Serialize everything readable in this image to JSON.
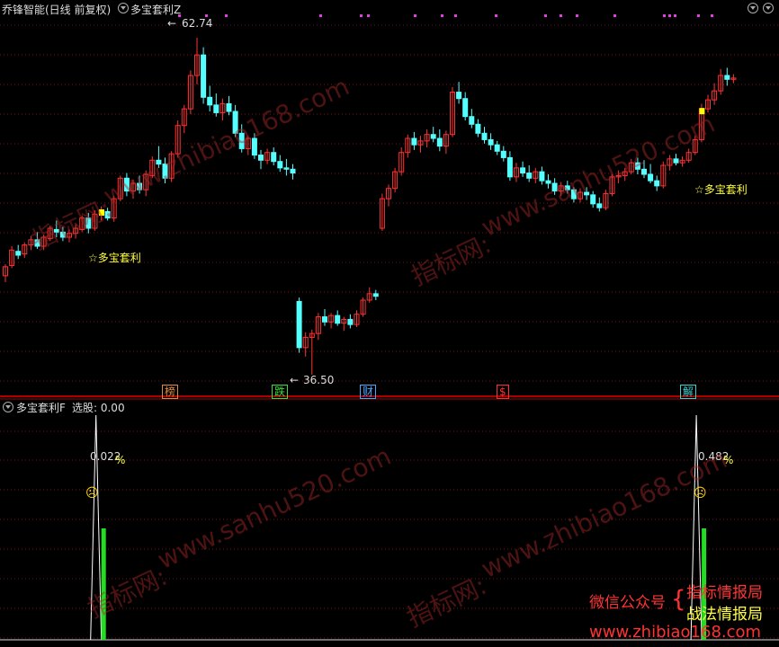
{
  "header": {
    "title": "乔锋智能(日线 前复权)",
    "indicator": "多宝套利Z",
    "sub_indicator": "多宝套利F",
    "sub_value": "选股: 0.00"
  },
  "price_labels": {
    "high": "62.74",
    "low": "36.50"
  },
  "signal_labels": {
    "left": "☆多宝套利",
    "right": "☆多宝套利"
  },
  "bottom_tags": [
    {
      "text": "榜",
      "color": "#e08a3c"
    },
    {
      "text": "跌",
      "color": "#3cdc3c"
    },
    {
      "text": "财",
      "color": "#4aa8ff"
    },
    {
      "text": "$",
      "color": "#ff3030"
    },
    {
      "text": "解",
      "color": "#3cd0d0"
    }
  ],
  "sub_labels": {
    "left_pct": "0.022",
    "right_pct": "0.482",
    "pct_sign": "%"
  },
  "watermarks": [
    "指标网:",
    "www.zhibiao168.com",
    "www.sanhu520.com"
  ],
  "ad": {
    "left": "微信公众号",
    "line1": "指标情报局",
    "line2": "战法情报局",
    "url": "www.zhibiao168.com"
  },
  "colors": {
    "up": "#ff3333",
    "down": "#54ffff",
    "signal": "#ffff00",
    "bar": "#22dd22"
  },
  "chart_data": {
    "type": "candlestick",
    "candles": [
      [
        44.2,
        45.1,
        43.7,
        44.9
      ],
      [
        45.0,
        46.5,
        44.8,
        46.2
      ],
      [
        46.1,
        46.6,
        45.5,
        45.8
      ],
      [
        45.9,
        46.8,
        45.6,
        46.6
      ],
      [
        46.6,
        47.3,
        46.2,
        47.0
      ],
      [
        47.0,
        47.6,
        46.3,
        46.5
      ],
      [
        46.5,
        47.4,
        46.2,
        47.2
      ],
      [
        47.1,
        48.1,
        46.9,
        47.9
      ],
      [
        47.8,
        48.5,
        47.2,
        47.6
      ],
      [
        47.6,
        48.0,
        46.9,
        47.2
      ],
      [
        47.2,
        47.8,
        46.8,
        47.5
      ],
      [
        47.5,
        48.2,
        47.1,
        47.9
      ],
      [
        47.8,
        48.9,
        47.6,
        48.7
      ],
      [
        48.7,
        49.1,
        47.5,
        47.9
      ],
      [
        47.9,
        49.3,
        47.7,
        49.0
      ],
      [
        49.0,
        49.6,
        48.5,
        49.3
      ],
      [
        49.2,
        49.5,
        48.5,
        48.7
      ],
      [
        48.7,
        50.4,
        48.4,
        50.2
      ],
      [
        50.2,
        52.0,
        50.0,
        51.8
      ],
      [
        51.8,
        52.2,
        50.4,
        50.8
      ],
      [
        50.8,
        51.7,
        50.2,
        51.4
      ],
      [
        51.4,
        52.0,
        50.6,
        50.9
      ],
      [
        50.9,
        52.4,
        50.4,
        52.1
      ],
      [
        52.0,
        53.5,
        51.8,
        53.2
      ],
      [
        53.2,
        54.3,
        52.6,
        52.9
      ],
      [
        52.9,
        53.4,
        51.4,
        51.8
      ],
      [
        51.8,
        53.9,
        51.5,
        53.7
      ],
      [
        53.7,
        56.3,
        53.4,
        55.9
      ],
      [
        55.9,
        57.5,
        55.3,
        57.2
      ],
      [
        57.2,
        60.2,
        56.8,
        59.8
      ],
      [
        59.8,
        62.74,
        59.1,
        61.4
      ],
      [
        61.4,
        62.0,
        57.6,
        58.1
      ],
      [
        58.1,
        59.0,
        57.0,
        57.5
      ],
      [
        57.5,
        58.4,
        56.6,
        56.9
      ],
      [
        56.9,
        58.0,
        56.3,
        57.6
      ],
      [
        57.6,
        58.2,
        56.7,
        57.0
      ],
      [
        57.0,
        57.5,
        55.0,
        55.3
      ],
      [
        55.3,
        56.0,
        53.8,
        54.1
      ],
      [
        54.1,
        55.1,
        53.6,
        54.9
      ],
      [
        54.9,
        55.3,
        53.3,
        53.6
      ],
      [
        53.6,
        54.0,
        52.5,
        53.2
      ],
      [
        53.2,
        54.1,
        52.9,
        53.8
      ],
      [
        53.8,
        54.2,
        52.8,
        53.1
      ],
      [
        53.1,
        53.6,
        52.3,
        52.6
      ],
      [
        52.6,
        53.3,
        52.0,
        52.5
      ],
      [
        52.5,
        52.9,
        51.7,
        52.2
      ],
      [
        42.2,
        42.5,
        38.2,
        38.6
      ],
      [
        38.6,
        39.8,
        37.9,
        39.4
      ],
      [
        39.4,
        40.0,
        36.5,
        39.7
      ],
      [
        39.7,
        41.3,
        39.2,
        41.0
      ],
      [
        41.0,
        41.6,
        40.3,
        40.6
      ],
      [
        40.6,
        41.3,
        40.1,
        41.1
      ],
      [
        41.1,
        41.5,
        40.3,
        40.5
      ],
      [
        40.5,
        41.0,
        39.9,
        40.8
      ],
      [
        40.8,
        41.2,
        40.1,
        40.4
      ],
      [
        40.4,
        41.5,
        40.2,
        41.2
      ],
      [
        41.2,
        42.5,
        41.0,
        42.3
      ],
      [
        42.3,
        43.3,
        42.1,
        42.8
      ],
      [
        42.8,
        43.1,
        42.3,
        42.6
      ],
      [
        47.9,
        50.6,
        47.7,
        50.2
      ],
      [
        50.2,
        51.3,
        49.6,
        51.0
      ],
      [
        51.0,
        52.6,
        50.7,
        52.3
      ],
      [
        52.3,
        54.2,
        52.0,
        53.8
      ],
      [
        53.8,
        55.2,
        53.4,
        54.9
      ],
      [
        54.9,
        55.4,
        54.0,
        54.4
      ],
      [
        54.4,
        55.1,
        53.8,
        54.7
      ],
      [
        54.7,
        55.6,
        54.2,
        55.2
      ],
      [
        55.2,
        55.8,
        54.6,
        54.9
      ],
      [
        54.9,
        55.6,
        53.9,
        54.3
      ],
      [
        54.3,
        55.5,
        53.7,
        55.2
      ],
      [
        55.2,
        58.9,
        55.0,
        58.5
      ],
      [
        58.5,
        59.3,
        57.6,
        58.0
      ],
      [
        58.0,
        58.5,
        56.3,
        56.6
      ],
      [
        56.6,
        57.2,
        55.7,
        56.0
      ],
      [
        56.0,
        56.4,
        55.0,
        55.3
      ],
      [
        55.3,
        55.8,
        54.5,
        54.8
      ],
      [
        54.8,
        55.3,
        54.0,
        54.4
      ],
      [
        54.4,
        54.7,
        53.6,
        53.9
      ],
      [
        53.9,
        54.3,
        53.1,
        53.4
      ],
      [
        53.4,
        53.9,
        51.6,
        51.9
      ],
      [
        51.9,
        53.0,
        51.5,
        52.6
      ],
      [
        52.6,
        53.1,
        51.9,
        52.2
      ],
      [
        52.2,
        52.8,
        51.5,
        51.8
      ],
      [
        51.8,
        52.6,
        51.4,
        52.3
      ],
      [
        52.3,
        52.7,
        51.3,
        51.6
      ],
      [
        51.6,
        52.1,
        51.0,
        51.4
      ],
      [
        51.4,
        51.8,
        50.5,
        50.8
      ],
      [
        50.8,
        51.5,
        50.4,
        51.2
      ],
      [
        51.2,
        51.6,
        50.6,
        50.9
      ],
      [
        50.9,
        51.1,
        49.9,
        50.2
      ],
      [
        50.2,
        51.0,
        49.9,
        50.7
      ],
      [
        50.7,
        51.1,
        50.1,
        50.5
      ],
      [
        50.5,
        50.8,
        49.5,
        49.8
      ],
      [
        49.8,
        50.3,
        49.2,
        49.5
      ],
      [
        49.5,
        50.9,
        49.3,
        50.6
      ],
      [
        50.6,
        52.1,
        50.4,
        51.9
      ],
      [
        51.9,
        52.4,
        51.4,
        52.0
      ],
      [
        52.0,
        52.6,
        51.6,
        52.3
      ],
      [
        52.3,
        53.3,
        52.1,
        53.0
      ],
      [
        53.0,
        53.4,
        52.1,
        52.5
      ],
      [
        52.5,
        53.2,
        51.8,
        52.1
      ],
      [
        52.1,
        52.9,
        51.4,
        51.6
      ],
      [
        51.6,
        52.0,
        50.8,
        51.2
      ],
      [
        51.2,
        53.1,
        51.0,
        52.8
      ],
      [
        52.8,
        53.6,
        52.4,
        53.3
      ],
      [
        53.3,
        53.7,
        52.8,
        53.0
      ],
      [
        53.0,
        53.5,
        52.7,
        53.2
      ],
      [
        53.2,
        54.1,
        53.0,
        53.8
      ],
      [
        53.8,
        55.1,
        53.6,
        54.8
      ],
      [
        54.8,
        57.6,
        54.6,
        57.2
      ],
      [
        57.2,
        58.3,
        56.9,
        57.9
      ],
      [
        57.9,
        59.2,
        57.5,
        58.6
      ],
      [
        58.6,
        60.3,
        58.3,
        59.8
      ],
      [
        59.8,
        60.4,
        59.0,
        59.5
      ],
      [
        59.5,
        59.9,
        59.2,
        59.6
      ]
    ],
    "signals": [
      {
        "index": 15,
        "label": "☆多宝套利"
      },
      {
        "index": 109,
        "label": "☆多宝套利"
      }
    ],
    "sub_series": {
      "name": "多宝套利F",
      "spikes": [
        {
          "index": 17,
          "peak": 1.0,
          "value": 0.022
        },
        {
          "index": 111,
          "peak": 1.0,
          "value": 0.482
        }
      ]
    },
    "price_range": [
      36.0,
      64.0
    ]
  }
}
